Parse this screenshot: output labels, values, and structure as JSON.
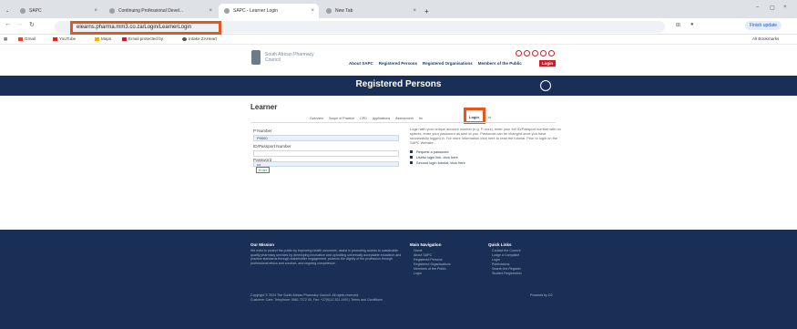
{
  "browser": {
    "tabs": [
      {
        "label": "SAPC"
      },
      {
        "label": "Continuing Professional Devel..."
      },
      {
        "label": "SAPC - Learner Login"
      },
      {
        "label": "New Tab"
      }
    ],
    "url": "elearns.pharma.mm3.co.za/Login/LearnerLogin",
    "update_label": "Finish update",
    "bookmarks": [
      "Gmail",
      "YouTube",
      "Maps",
      "Email protected by",
      "Intake ZAHeart"
    ],
    "all_bookmarks": "All Bookmarks"
  },
  "site": {
    "org_name": "South African Pharmacy Council",
    "nav": [
      "About SAPC",
      "Registered Persons",
      "Registered Organisations",
      "Members of the Public"
    ],
    "login_label": "Login",
    "banner_title": "Registered Persons"
  },
  "learner": {
    "title": "Learner",
    "tabs": [
      "Overview",
      "Scope of Practice",
      "CPD",
      "Applications",
      "Assessment",
      "Im",
      "Login",
      "nt"
    ],
    "fields": {
      "p_number_label": "P Number",
      "p_number_value": "P0000",
      "id_label": "ID/Passport Number",
      "id_value": "",
      "password_label": "Password",
      "password_value": "•••"
    },
    "enter_label": "Enter",
    "info_text": "Login with your unique account number (e.g. P-xxxx), enter your full ID/Passport number with no spaces, enter your password as sent to you. Password can be changed once you have successfully logged in. For more information click here to read the tutorial. Prior to login on the SAPC Website.",
    "info_links": [
      "Request a password",
      "Useful login link, click here",
      "Second login tutorial, click here"
    ]
  },
  "footer": {
    "mission_title": "Our Mission",
    "mission_text": "We exist to protect the public by improving health outcomes, assist in promoting access to sustainable quality pharmacy services by developing innovative and upholding universally acceptable education and practice standards through stakeholder engagement, protects the dignity of the profession through professional ethics and conduct, and ongoing competence.",
    "nav_title": "Main Navigation",
    "nav_links": [
      "Home",
      "About SAPC",
      "Registered Persons",
      "Registered Organisations",
      "Members of the Public",
      "Login"
    ],
    "quick_title": "Quick Links",
    "quick_links": [
      "Contact the Council",
      "Lodge a Complaint",
      "Login",
      "Publications",
      "Search the Register",
      "Student Registration"
    ],
    "copyright": "Copyright © 2024 The South African Pharmacy Council. All rights reserved.",
    "contact": "Customer Care: Telephone: 0861 7272 00, Fax: +27(0)12 321 1492 | Terms and Conditions",
    "powered": "Powered by D2"
  }
}
